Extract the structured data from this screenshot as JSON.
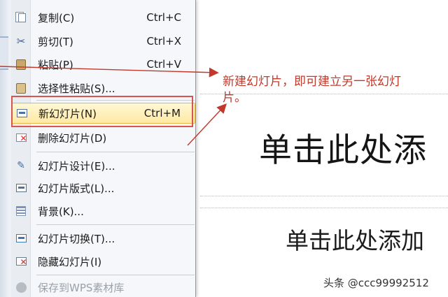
{
  "menu": {
    "items": [
      {
        "label": "复制(C)",
        "shortcut": "Ctrl+C",
        "icon": "copy-icon"
      },
      {
        "label": "剪切(T)",
        "shortcut": "Ctrl+X",
        "icon": "cut-icon"
      },
      {
        "label": "粘贴(P)",
        "shortcut": "Ctrl+V",
        "icon": "paste-icon"
      },
      {
        "label": "选择性粘贴(S)...",
        "shortcut": "",
        "icon": "paste-special-icon"
      },
      {
        "label": "新幻灯片(N)",
        "shortcut": "Ctrl+M",
        "icon": "new-slide-icon"
      },
      {
        "label": "删除幻灯片(D)",
        "shortcut": "",
        "icon": "delete-slide-icon"
      },
      {
        "label": "幻灯片设计(E)...",
        "shortcut": "",
        "icon": "slide-design-icon"
      },
      {
        "label": "幻灯片版式(L)...",
        "shortcut": "",
        "icon": "slide-layout-icon"
      },
      {
        "label": "背景(K)...",
        "shortcut": "",
        "icon": "background-icon"
      },
      {
        "label": "幻灯片切换(T)...",
        "shortcut": "",
        "icon": "slide-transition-icon"
      },
      {
        "label": "隐藏幻灯片(I)",
        "shortcut": "",
        "icon": "hide-slide-icon"
      },
      {
        "label": "保存到WPS素材库",
        "shortcut": "",
        "icon": "save-library-icon"
      }
    ]
  },
  "annotation": {
    "text": "新建幻灯片，即可建立另一张幻灯片。"
  },
  "slide": {
    "title_placeholder": "单击此处添",
    "subtitle_placeholder": "单击此处添加"
  },
  "watermark": "头条 @ccc99992512",
  "colors": {
    "highlight_border": "#e6b84a",
    "annotation_red": "#c0392b"
  }
}
